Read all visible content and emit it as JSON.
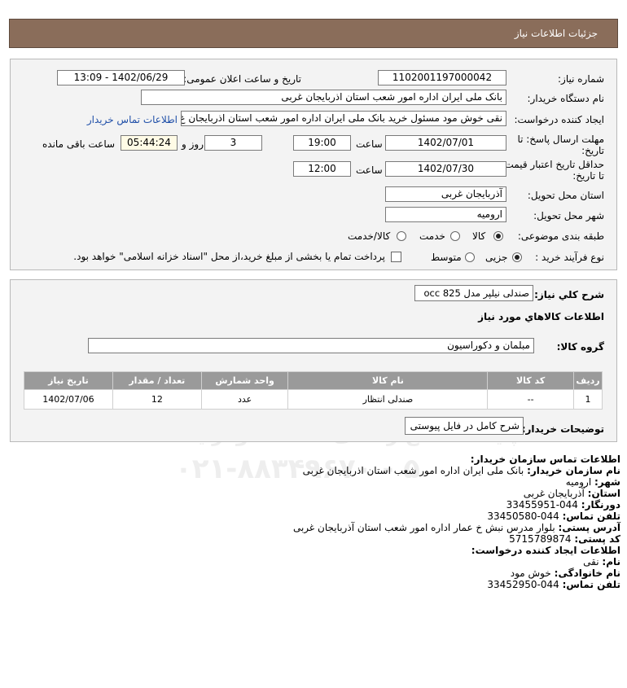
{
  "header": {
    "title": "جزئیات اطلاعات نیاز"
  },
  "form": {
    "need_number": {
      "label": "شماره نیاز:",
      "value": "1102001197000042"
    },
    "announce_datetime": {
      "label": "تاریخ و ساعت اعلان عمومی:",
      "value": "1402/06/29 - 13:09"
    },
    "buyer_org": {
      "label": "نام دستگاه خریدار:",
      "value": "بانک ملی ایران اداره امور شعب استان اذربایجان غربی"
    },
    "requester": {
      "label": "ایجاد کننده درخواست:",
      "value": "نقی  خوش مود مسئول خرید بانک ملی ایران اداره امور شعب استان اذربایجان غ",
      "link": "اطلاعات تماس خریدار"
    },
    "deadline": {
      "label": "مهلت ارسال پاسخ: تا تاریخ:",
      "date": "1402/07/01",
      "time_label": "ساعت",
      "time": "19:00",
      "days": "3",
      "days_label": "روز و",
      "remaining": "05:44:24",
      "remaining_label": "ساعت باقی مانده"
    },
    "validity": {
      "label": "حداقل تاریخ اعتبار قیمت: تا تاریخ:",
      "date": "1402/07/30",
      "time_label": "ساعت",
      "time": "12:00"
    },
    "delivery_province": {
      "label": "استان محل تحویل:",
      "value": "آذربایجان غربی"
    },
    "delivery_city": {
      "label": "شهر محل تحویل:",
      "value": "ارومیه"
    },
    "category": {
      "label": "طبقه بندی موضوعی:",
      "options": [
        "کالا",
        "خدمت",
        "کالا/خدمت"
      ],
      "selected": "کالا"
    },
    "process": {
      "label": "نوع فرآیند خرید :",
      "options": [
        "جزیی",
        "متوسط"
      ],
      "selected": "جزیی",
      "checkbox_text": "پرداخت تمام یا بخشی از مبلغ خرید،از محل \"اسناد خزانه اسلامی\" خواهد بود."
    }
  },
  "summary": {
    "label": "شرح کلي نياز:",
    "value": "صندلی نیلپر مدل occ 825",
    "goods_title": "اطلاعات کالاهاي مورد نياز",
    "group_label": "گروه کالا:",
    "group_value": "مبلمان و دکوراسیون",
    "table": {
      "headers": [
        "ردیف",
        "کد کالا",
        "نام کالا",
        "واحد شمارش",
        "تعداد / مقدار",
        "تاریخ نیاز"
      ],
      "rows": [
        [
          "1",
          "--",
          "صندلی انتظار",
          "عدد",
          "12",
          "1402/07/06"
        ]
      ]
    },
    "buyer_notes_label": "توضیحات خریدار:",
    "buyer_notes_value": "شرح کامل در فایل پیوستی"
  },
  "contact": {
    "title": "اطلاعات تماس سازمان خریدار:",
    "org_label": "نام سازمان خریدار:",
    "org": "بانک ملی ایران اداره امور شعب استان اذربایجان غربی",
    "city_label": "شهر:",
    "city": "ارومیه",
    "province_label": "استان:",
    "province": "آذربایجان غربی",
    "fax_label": "دورنگار:",
    "fax": "044-33455951",
    "phone_label": "تلفن تماس:",
    "phone": "044-33450580",
    "address_label": "آدرس پستی:",
    "address": "بلوار مدرس نبش خ عمار اداره امور شعب استان آذربایجان غربی",
    "postal_label": "کد پستی:",
    "postal": "5715789874",
    "creator_title": "اطلاعات ایجاد کننده درخواست:",
    "name_label": "نام:",
    "name": "نقی",
    "family_label": "نام خانوادگی:",
    "family": "خوش مود",
    "creator_phone_label": "تلفن تماس:",
    "creator_phone": "044-33452950"
  },
  "watermark": {
    "brand": "ParsNamadData",
    "line1": "مرکز فراوری اطلاعات پارس نماد داده ها",
    "line2": "پایگاه اطلاع رسانی مناقصه ومزایده",
    "phone": "۰۲۱-۸۸۳۴۹۶۷۰ - ۵"
  }
}
